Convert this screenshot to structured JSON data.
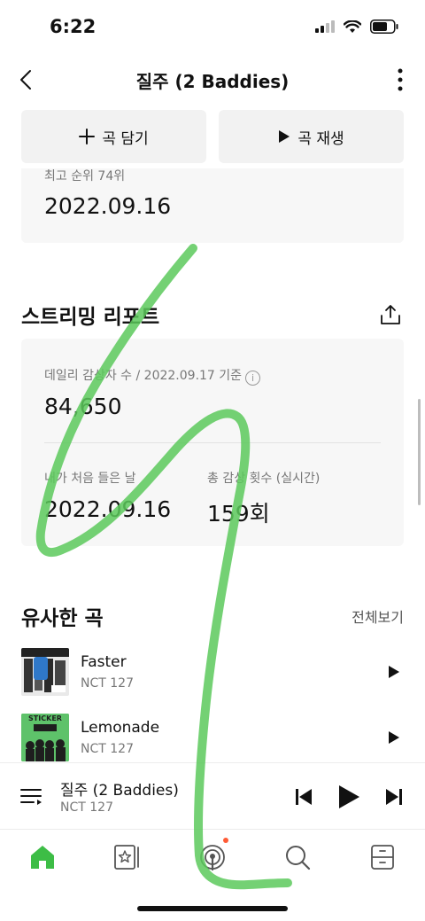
{
  "status_bar": {
    "time": "6:22"
  },
  "nav": {
    "title": "질주 (2 Baddies)"
  },
  "actions": {
    "add_label": "곡 담기",
    "play_label": "곡 재생"
  },
  "peak_card": {
    "label": "최고 순위 74위",
    "date": "2022.09.16"
  },
  "streaming_report": {
    "title": "스트리밍 리포트",
    "daily_listeners_label": "데일리 감상자 수 / 2022.09.17 기준",
    "daily_listeners_value": "84,650",
    "first_listened_label": "내가 처음 들은 날",
    "first_listened_value": "2022.09.16",
    "total_plays_label": "총 감상 횟수 (실시간)",
    "total_plays_value": "159회"
  },
  "similar_songs": {
    "title": "유사한 곡",
    "see_all": "전체보기",
    "items": [
      {
        "title": "Faster",
        "artist": "NCT 127"
      },
      {
        "title": "Lemonade",
        "artist": "NCT 127",
        "art_text": "STICKER"
      }
    ]
  },
  "now_playing": {
    "title": "질주 (2 Baddies)",
    "artist": "NCT 127"
  },
  "tabs": [
    {
      "icon": "home-icon",
      "active": true
    },
    {
      "icon": "library-icon",
      "active": false
    },
    {
      "icon": "podcast-icon",
      "active": false,
      "notification": true
    },
    {
      "icon": "search-icon",
      "active": false
    },
    {
      "icon": "storage-icon",
      "active": false
    }
  ],
  "colors": {
    "accent": "#3dbd46",
    "scribble": "#5cc95c",
    "card_bg": "#f7f7f7",
    "notification": "#ff5b36"
  }
}
